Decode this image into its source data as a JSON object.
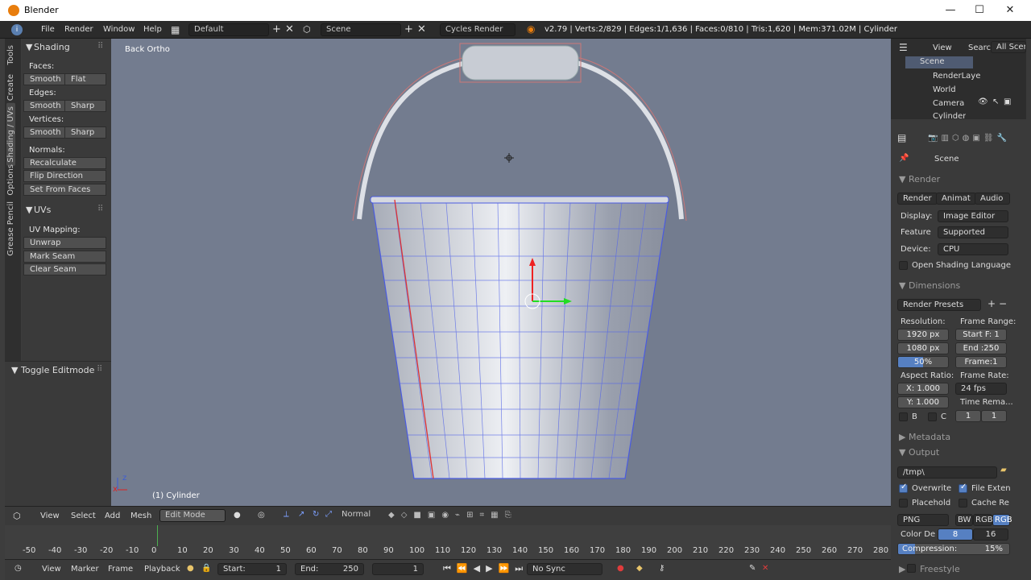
{
  "window": {
    "title": "Blender",
    "min": "—",
    "max": "☐",
    "close": "✕"
  },
  "info": {
    "menus": [
      "File",
      "Render",
      "Window",
      "Help"
    ],
    "layout": "Default",
    "scene": "Scene",
    "engine": "Cycles Render",
    "stats": "v2.79 | Verts:2/829 | Edges:1/1,636 | Faces:0/810 | Tris:1,620 | Mem:371.02M | Cylinder"
  },
  "left_tabs": [
    "Tools",
    "Create",
    "Shading / UVs",
    "Options",
    "Grease Pencil"
  ],
  "shading_panel": {
    "header": "Shading",
    "faces_label": "Faces:",
    "faces": [
      "Smooth",
      "Flat"
    ],
    "edges_label": "Edges:",
    "edges": [
      "Smooth",
      "Sharp"
    ],
    "verts_label": "Vertices:",
    "verts": [
      "Smooth",
      "Sharp"
    ],
    "normals_label": "Normals:",
    "normals": [
      "Recalculate",
      "Flip Direction",
      "Set From Faces"
    ]
  },
  "uvs_panel": {
    "header": "UVs",
    "mapping_label": "UV Mapping:",
    "buttons": [
      "Unwrap",
      "Mark Seam",
      "Clear Seam"
    ]
  },
  "toggle_panel": {
    "header": "Toggle Editmode"
  },
  "viewport": {
    "view_name": "Back Ortho",
    "object": "(1) Cylinder",
    "axis_x": "x",
    "axis_z": "z"
  },
  "outliner": {
    "tabs": [
      "View",
      "Search",
      "All Scenes"
    ],
    "items": [
      "Scene",
      "RenderLaye",
      "World",
      "Camera",
      "Cylinder"
    ]
  },
  "properties": {
    "context": "Scene",
    "render": {
      "header": "Render",
      "tabs": [
        "Render",
        "Animat",
        "Audio"
      ],
      "display_label": "Display:",
      "display": "Image Editor",
      "feature_label": "Feature",
      "feature": "Supported",
      "device_label": "Device:",
      "device": "CPU",
      "osl": "Open Shading Language"
    },
    "dimensions": {
      "header": "Dimensions",
      "presets": "Render Presets",
      "resolution_label": "Resolution:",
      "res_x": "1920 px",
      "res_y": "1080 px",
      "res_pct": "50%",
      "res_pct_value": 0.5,
      "frame_range_label": "Frame Range:",
      "start": "Start F: 1",
      "end": "End :250",
      "frame": "Frame:1",
      "aspect_label": "Aspect Ratio:",
      "aspect_x": "X:  1.000",
      "aspect_y": "Y:  1.000",
      "fps_label": "Frame Rate:",
      "fps": "24 fps",
      "time_label": "Time Rema...",
      "b": "B",
      "c": "C",
      "t1": "1",
      "t2": "1"
    },
    "metadata": {
      "header": "Metadata"
    },
    "output": {
      "header": "Output",
      "path": "/tmp\\",
      "overwrite": "Overwrite",
      "file_ext": "File Exten",
      "placeholders": "Placehold",
      "cache": "Cache Re",
      "format": "PNG",
      "bw": "BW",
      "rgb": "RGB",
      "rgba": "RGB",
      "color_depth_label": "Color De",
      "depth8": "8",
      "depth16": "16",
      "compression_label": "Compression:",
      "compression": "15%",
      "compression_value": 0.15
    },
    "freestyle": {
      "header": "Freestyle"
    }
  },
  "vp_header": {
    "items": [
      "View",
      "Select",
      "Add",
      "Mesh"
    ],
    "mode": "Edit Mode",
    "pivot": "Normal"
  },
  "timeline": {
    "ticks": [
      "-50",
      "-40",
      "-30",
      "-20",
      "-10",
      "0",
      "10",
      "20",
      "30",
      "40",
      "50",
      "60",
      "70",
      "80",
      "90",
      "100",
      "110",
      "120",
      "130",
      "140",
      "150",
      "160",
      "170",
      "180",
      "190",
      "200",
      "210",
      "220",
      "230",
      "240",
      "250",
      "260",
      "270",
      "280"
    ],
    "menus": [
      "View",
      "Marker",
      "Frame",
      "Playback"
    ],
    "start_label": "Start:",
    "start": "1",
    "end_label": "End:",
    "end": "250",
    "current": "1",
    "sync": "No Sync"
  },
  "colors": {
    "viewport": "#737c8f",
    "accent": "#5680c2",
    "logo": "#e87d0d"
  }
}
